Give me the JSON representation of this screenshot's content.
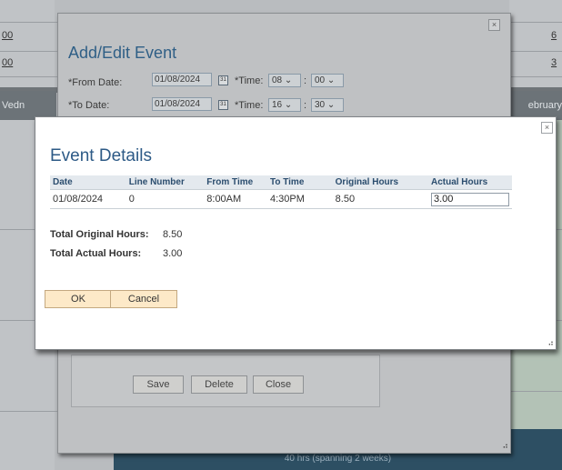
{
  "background": {
    "left_values": [
      "00",
      "00"
    ],
    "right_values": [
      "6",
      "3"
    ],
    "header_left": "Vedn",
    "header_right": "ebruary",
    "footer_text": "40 hrs (spanning 2 weeks)"
  },
  "add_edit_event": {
    "close": "×",
    "title": "Add/Edit Event",
    "from_date_label": "*From Date:",
    "from_date_value": "01/08/2024",
    "from_time_label": "*Time:",
    "from_hour": "08",
    "from_minute": "00",
    "to_date_label": "*To Date:",
    "to_date_value": "01/08/2024",
    "to_time_label": "*Time:",
    "to_hour": "16",
    "to_minute": "30",
    "time_separator": ":",
    "calendar_glyph": "31",
    "save_label": "Save",
    "delete_label": "Delete",
    "close_label": "Close"
  },
  "event_details": {
    "close": "×",
    "title": "Event Details",
    "columns": [
      "Date",
      "Line Number",
      "From Time",
      "To Time",
      "Original Hours",
      "Actual Hours"
    ],
    "rows": [
      {
        "date": "01/08/2024",
        "line_number": "0",
        "from_time": "8:00AM",
        "to_time": "4:30PM",
        "original_hours": "8.50",
        "actual_hours": "3.00"
      }
    ],
    "total_original_label": "Total Original Hours:",
    "total_original_value": "8.50",
    "total_actual_label": "Total Actual Hours:",
    "total_actual_value": "3.00",
    "ok_label": "OK",
    "cancel_label": "Cancel"
  },
  "colors": {
    "title_blue": "#2d5a86",
    "button_fill": "#fde9c8",
    "header_fill": "#e4e9ee"
  }
}
